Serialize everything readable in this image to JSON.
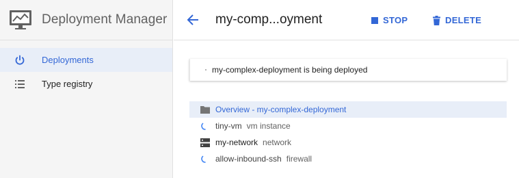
{
  "app": {
    "title": "Deployment Manager",
    "icon": "monitor-chart-icon"
  },
  "sidebar": {
    "items": [
      {
        "label": "Deployments",
        "icon": "power-icon",
        "active": true
      },
      {
        "label": "Type registry",
        "icon": "list-icon",
        "active": false
      }
    ]
  },
  "header": {
    "back_icon": "arrow-back-icon",
    "title": "my-comp...oyment",
    "stop_label": "STOP",
    "delete_label": "DELETE"
  },
  "status": {
    "message": "my-complex-deployment is being deployed"
  },
  "tree": {
    "rows": [
      {
        "name": "Overview - my-complex-deployment",
        "type": "",
        "icon": "folder-icon",
        "selected": true
      },
      {
        "name": "tiny-vm",
        "type": "vm instance",
        "icon": "loading-spinner-icon",
        "selected": false
      },
      {
        "name": "my-network",
        "type": "network",
        "icon": "network-icon",
        "selected": false
      },
      {
        "name": "allow-inbound-ssh",
        "type": "firewall",
        "icon": "loading-spinner-icon",
        "selected": false
      }
    ]
  },
  "colors": {
    "accent": "#3367d6",
    "sidebar_bg": "#f5f5f5",
    "active_bg": "#e8eef8",
    "text": "#212121",
    "muted": "#616161"
  }
}
